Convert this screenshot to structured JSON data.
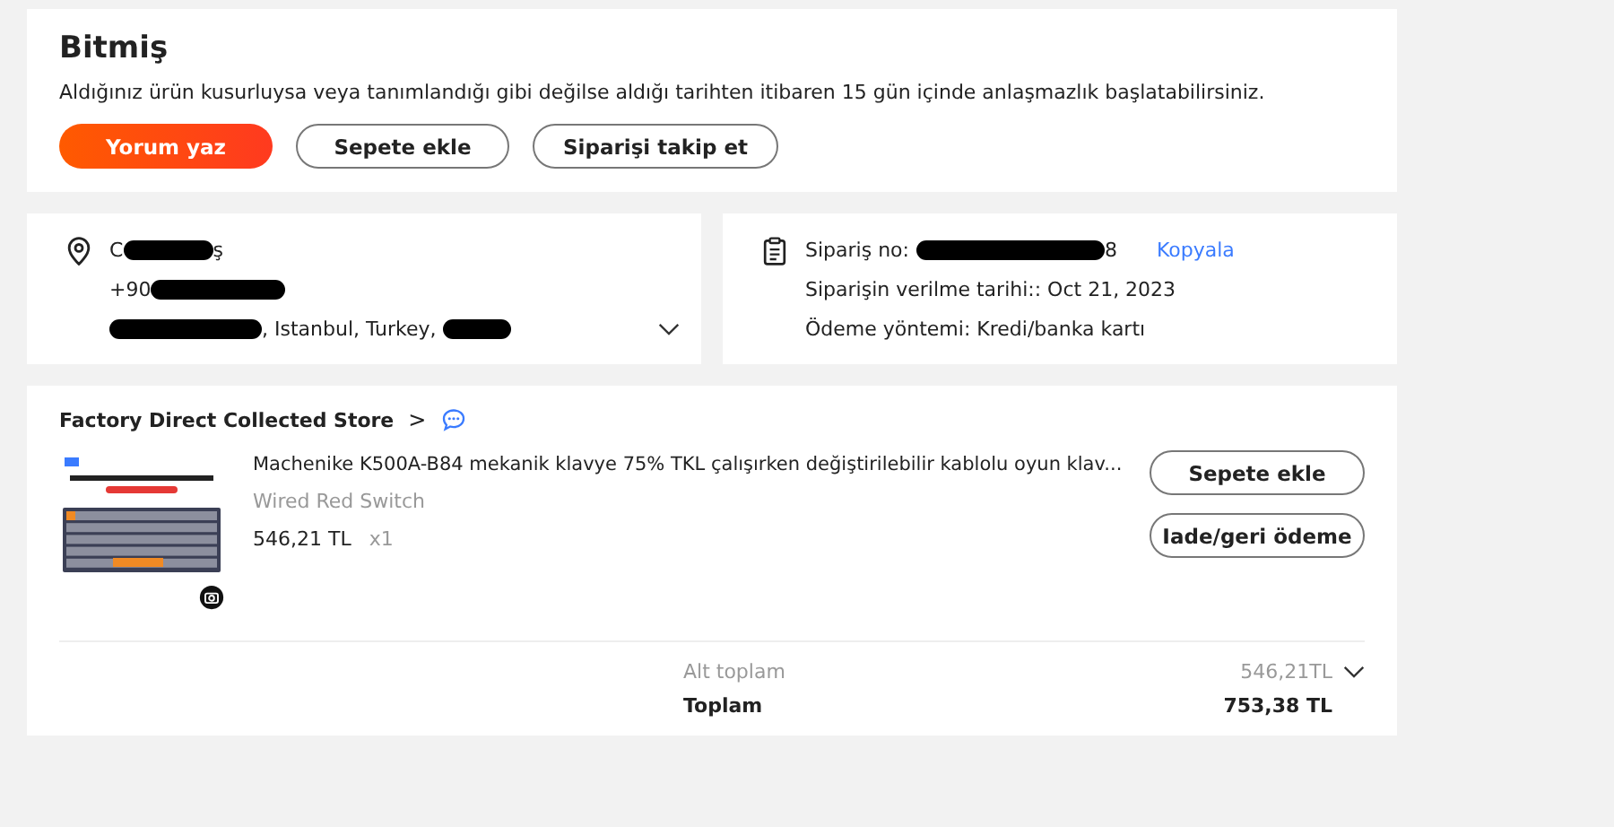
{
  "status": {
    "title": "Bitmiş",
    "message": "Aldığınız ürün kusurluysa veya tanımlandığı gibi değilse aldığı tarihten itibaren 15 gün içinde anlaşmazlık başlatabilirsiniz.",
    "buttons": [
      {
        "label": "Yorum yaz",
        "kind": "primary"
      },
      {
        "label": "Sepete ekle",
        "kind": "outline"
      },
      {
        "label": "Siparişi takip et",
        "kind": "outline"
      }
    ]
  },
  "address": {
    "name_start": "C",
    "name_end": "ş",
    "phone": "+90",
    "address_text": ", Istanbul, Turkey,"
  },
  "order": {
    "number_label": "Sipariş no:",
    "number_end": "8",
    "copy_link": "Kopyala",
    "date": "Siparişin verilme tarihi:: Oct 21, 2023",
    "payment": "Ödeme yöntemi: Kredi/banka kartı"
  },
  "store": {
    "name": "Factory Direct Collected Store",
    "chevron": ">"
  },
  "item": {
    "title": "Machenike K500A-B84 mekanik klavye 75% TKL çalışırken değiştirilebilir kablolu oyun klav...",
    "variant": "Wired Red Switch",
    "price": "546,21 TL",
    "quantity": "x1",
    "buttons": [
      "Sepete ekle",
      "Iade/geri ödeme"
    ]
  },
  "totals": {
    "subtotal_label": "Alt toplam",
    "subtotal": "546,21TL",
    "total_label": "Toplam",
    "total": "753,38 TL"
  }
}
